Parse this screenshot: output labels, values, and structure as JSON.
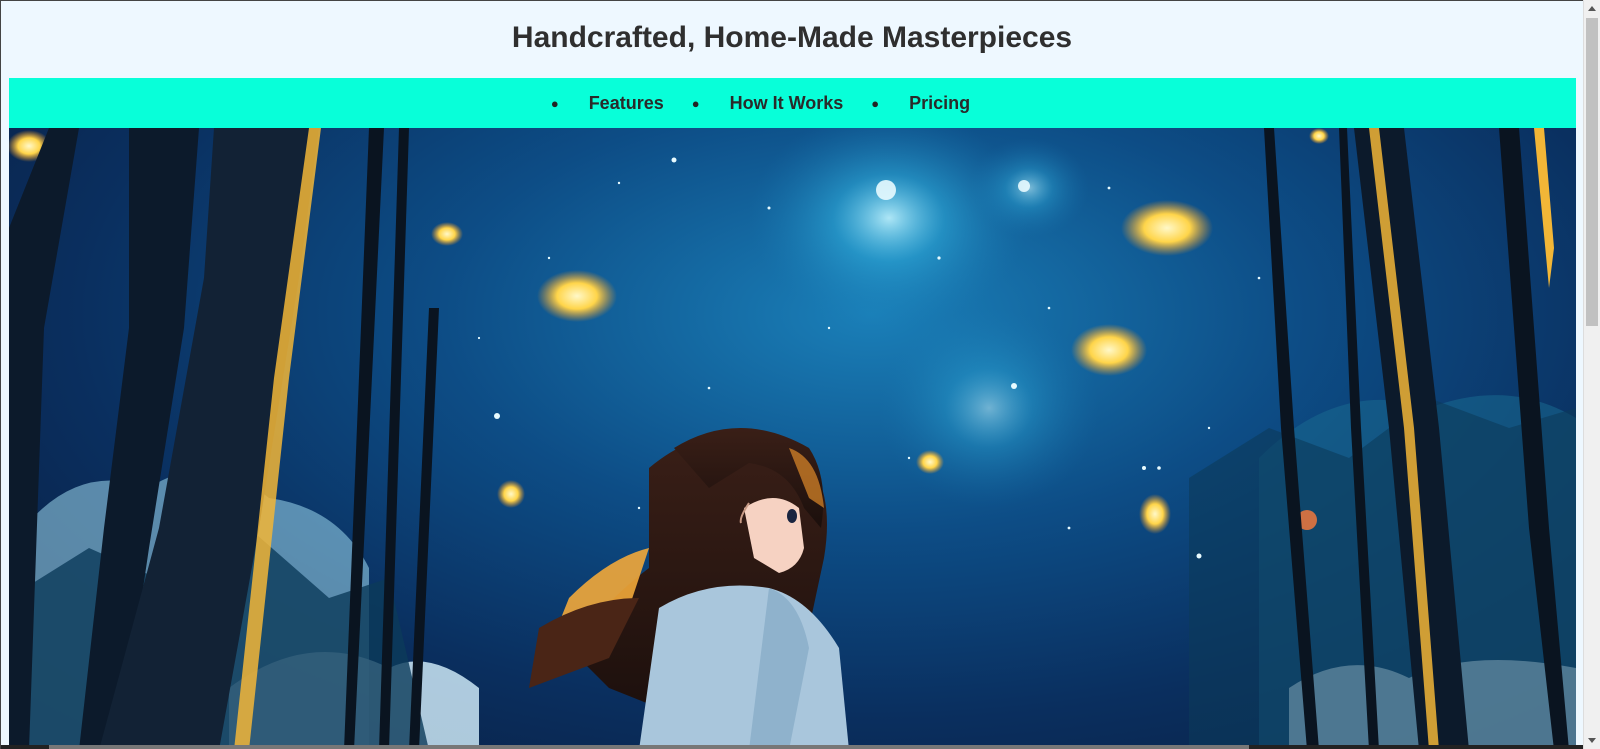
{
  "header": {
    "title": "Handcrafted, Home-Made Masterpieces"
  },
  "nav": {
    "items": [
      {
        "label": "Features"
      },
      {
        "label": "How It Works"
      },
      {
        "label": "Pricing"
      }
    ],
    "background_color": "#08ffd9"
  },
  "hero": {
    "image_icon": "anime-girl-starry-forest-image"
  },
  "page": {
    "background_color": "#eef8ff"
  }
}
